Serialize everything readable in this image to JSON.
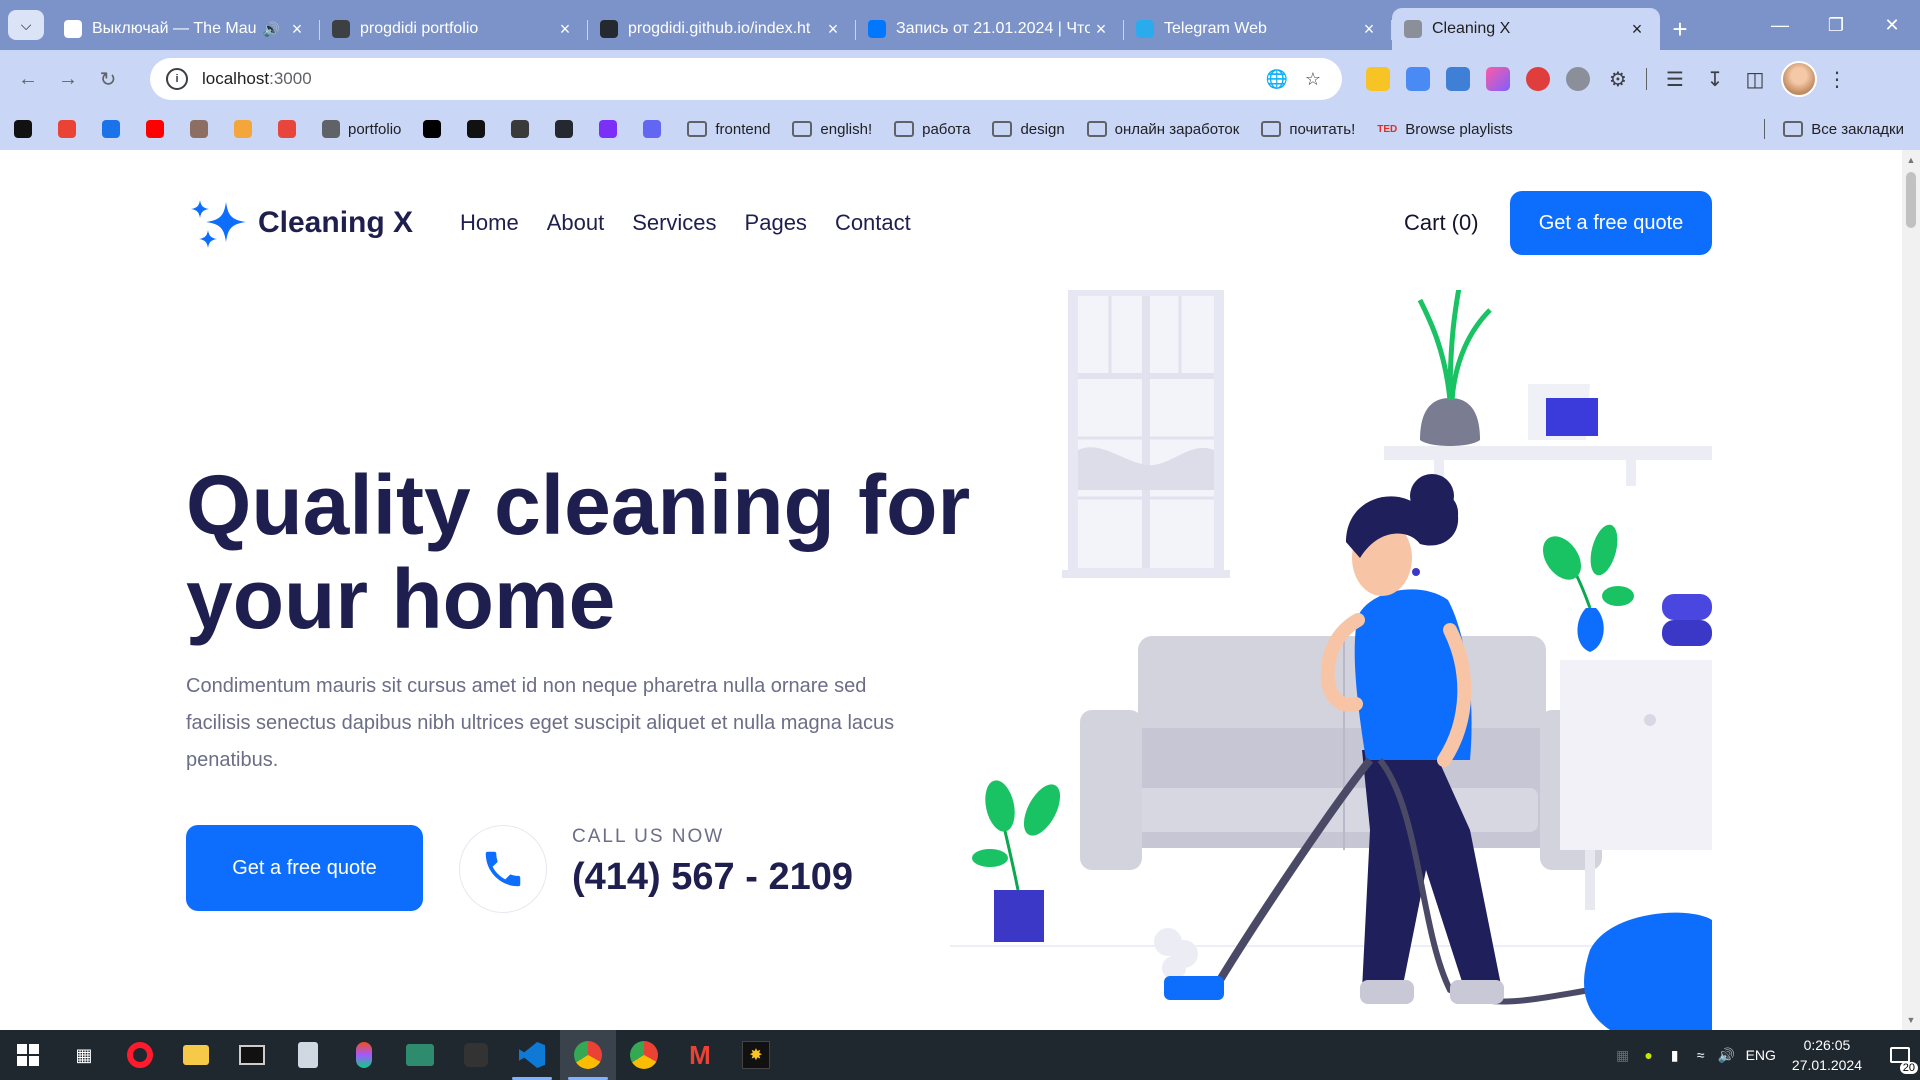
{
  "browser": {
    "tabs": [
      {
        "title": "Выключай — The Mau",
        "favicon_color": "#ffffff",
        "audio": true,
        "active": false
      },
      {
        "title": "progdidi portfolio",
        "favicon_color": "#3c4043",
        "audio": false,
        "active": false
      },
      {
        "title": "progdidi.github.io/index.ht",
        "favicon_color": "#24292f",
        "audio": false,
        "active": false
      },
      {
        "title": "Запись от 21.01.2024 | Что",
        "favicon_color": "#0077ff",
        "audio": false,
        "active": false
      },
      {
        "title": "Telegram Web",
        "favicon_color": "#2aabee",
        "audio": false,
        "active": false
      },
      {
        "title": "Cleaning X",
        "favicon_color": "#8a8f99",
        "audio": false,
        "active": true
      }
    ],
    "new_tab_label": "+",
    "url_host": "localhost",
    "url_port": ":3000",
    "bookmarks": [
      {
        "label": "",
        "color": "#111111"
      },
      {
        "label": "",
        "color": "#ea4335"
      },
      {
        "label": "",
        "color": "#1a73e8"
      },
      {
        "label": "",
        "color": "#ff0000"
      },
      {
        "label": "",
        "color": "#8d6e63"
      },
      {
        "label": "",
        "color": "#f4a63a"
      },
      {
        "label": "",
        "color": "#e8453c"
      },
      {
        "label": "portfolio",
        "color": "#5f6368"
      },
      {
        "label": "",
        "color": "#000000"
      },
      {
        "label": "",
        "color": "#111111"
      },
      {
        "label": "",
        "color": "#3a3a3a"
      },
      {
        "label": "",
        "color": "#24292f"
      },
      {
        "label": "",
        "color": "#7b2ff7"
      },
      {
        "label": "",
        "color": "#6366f1"
      }
    ],
    "bookmark_folders": [
      "frontend",
      "english!",
      "работа",
      "design",
      "онлайн заработок",
      "почитать!"
    ],
    "ted_label": "TED",
    "ted_bookmark": "Browse playlists",
    "all_bookmarks": "Все закладки"
  },
  "site": {
    "brand": "Cleaning X",
    "nav": [
      "Home",
      "About",
      "Services",
      "Pages",
      "Contact"
    ],
    "cart": "Cart (0)",
    "header_cta": "Get a free quote",
    "hero_title_line1": "Quality cleaning for",
    "hero_title_line2": "your home",
    "hero_text": "Condimentum mauris sit cursus amet id non neque pharetra nulla ornare sed facilisis senectus dapibus nibh ultrices eget suscipit aliquet et nulla magna lacus penatibus.",
    "hero_cta": "Get a free quote",
    "call_label": "CALL US NOW",
    "call_number": "(414) 567 - 2109",
    "colors": {
      "primary": "#0d6efd",
      "heading": "#1f1f4f",
      "muted": "#6b6e86"
    }
  },
  "taskbar": {
    "lang": "ENG",
    "time": "0:26:05",
    "date": "27.01.2024",
    "notifications": "20"
  }
}
